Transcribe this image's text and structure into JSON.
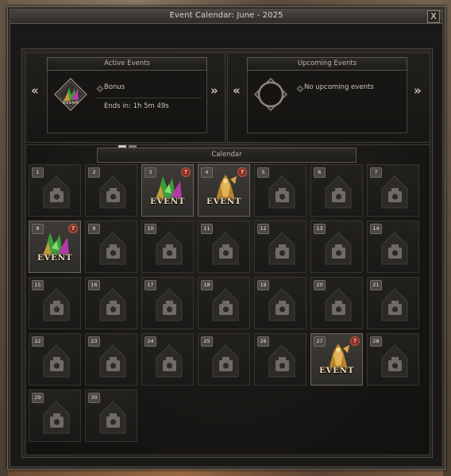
{
  "window": {
    "title": "Event Calendar: June - 2025",
    "close_label": "X"
  },
  "active": {
    "title": "Active Events",
    "event_name": "Bonus",
    "ends_in": "Ends in: 1h 5m 49s",
    "icon_label": "EVENT",
    "prev_label": "«",
    "next_label": "»",
    "pages": 2,
    "current_page": 1
  },
  "upcoming": {
    "title": "Upcoming Events",
    "message": "No upcoming events",
    "prev_label": "«",
    "next_label": "»"
  },
  "calendar": {
    "title": "Calendar",
    "event_label": "EVENT",
    "help_label": "?",
    "days": [
      {
        "day": "1",
        "event": false
      },
      {
        "day": "2",
        "event": false
      },
      {
        "day": "3",
        "event": true,
        "kind": "green"
      },
      {
        "day": "4",
        "event": true,
        "kind": "gold"
      },
      {
        "day": "5",
        "event": false
      },
      {
        "day": "6",
        "event": false
      },
      {
        "day": "7",
        "event": false
      },
      {
        "day": "8",
        "event": true,
        "kind": "green"
      },
      {
        "day": "9",
        "event": false
      },
      {
        "day": "10",
        "event": false
      },
      {
        "day": "11",
        "event": false
      },
      {
        "day": "12",
        "event": false
      },
      {
        "day": "13",
        "event": false
      },
      {
        "day": "14",
        "event": false
      },
      {
        "day": "15",
        "event": false
      },
      {
        "day": "16",
        "event": false
      },
      {
        "day": "17",
        "event": false
      },
      {
        "day": "18",
        "event": false
      },
      {
        "day": "19",
        "event": false
      },
      {
        "day": "20",
        "event": false
      },
      {
        "day": "21",
        "event": false
      },
      {
        "day": "22",
        "event": false
      },
      {
        "day": "23",
        "event": false
      },
      {
        "day": "24",
        "event": false
      },
      {
        "day": "25",
        "event": false
      },
      {
        "day": "26",
        "event": false
      },
      {
        "day": "27",
        "event": true,
        "kind": "gold"
      },
      {
        "day": "28",
        "event": false
      },
      {
        "day": "29",
        "event": false
      },
      {
        "day": "30",
        "event": false
      }
    ]
  },
  "colors": {
    "event_green": "#3f9b3a",
    "event_gold": "#c8962e",
    "accent_text": "#c9c3b5",
    "help_badge": "#8a2e22"
  }
}
